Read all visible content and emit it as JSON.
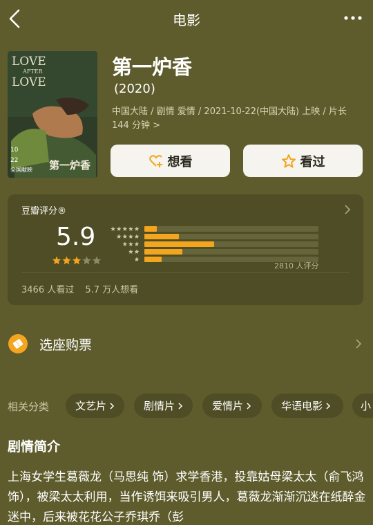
{
  "header": {
    "title": "电影",
    "back_icon": "chevron-left-icon",
    "more_icon": "more-dots-icon"
  },
  "movie": {
    "poster": {
      "text_top": [
        "LOVE",
        "AFTER",
        "LOVE"
      ],
      "calligraphy": "第一炉香",
      "date_line": [
        "10",
        "22"
      ],
      "release_tag": "全国献映"
    },
    "title": "第一炉香",
    "year": "(2020)",
    "meta": "中国大陆 / 剧情 爱情 / 2021-10-22(中国大陆) 上映 / 片长144 分钟 >"
  },
  "actions": {
    "want_label": "想看",
    "seen_label": "看过",
    "want_icon": "heart-plus-icon",
    "seen_icon": "star-outline-icon"
  },
  "rating": {
    "label": "豆瓣评分®",
    "score": "5.9",
    "stars": 3,
    "distribution": [
      {
        "stars": 5,
        "pct": 7
      },
      {
        "stars": 4,
        "pct": 20
      },
      {
        "stars": 3,
        "pct": 40
      },
      {
        "stars": 2,
        "pct": 22
      },
      {
        "stars": 1,
        "pct": 10
      }
    ],
    "count_text": "2810 人评分",
    "watched_text": "3466 人看过",
    "want_text": "5.7 万人想看"
  },
  "tickets": {
    "label": "选座购票",
    "icon": "ticket-icon"
  },
  "related": {
    "label": "相关分类",
    "chips": [
      "文艺片",
      "剧情片",
      "爱情片",
      "华语电影",
      "小"
    ]
  },
  "synopsis": {
    "title": "剧情简介",
    "text": "上海女学生葛薇龙（马思纯 饰）求学香港，投靠姑母梁太太（俞飞鸿 饰），被梁太太利用，当作诱饵来吸引男人，葛薇龙渐渐沉迷在纸醉金迷中，后来被花花公子乔琪乔（彭"
  },
  "colors": {
    "background": "#5e5c2c",
    "card": "#4f4d25",
    "accent": "#f3a51e",
    "button": "#f5f4ee"
  }
}
